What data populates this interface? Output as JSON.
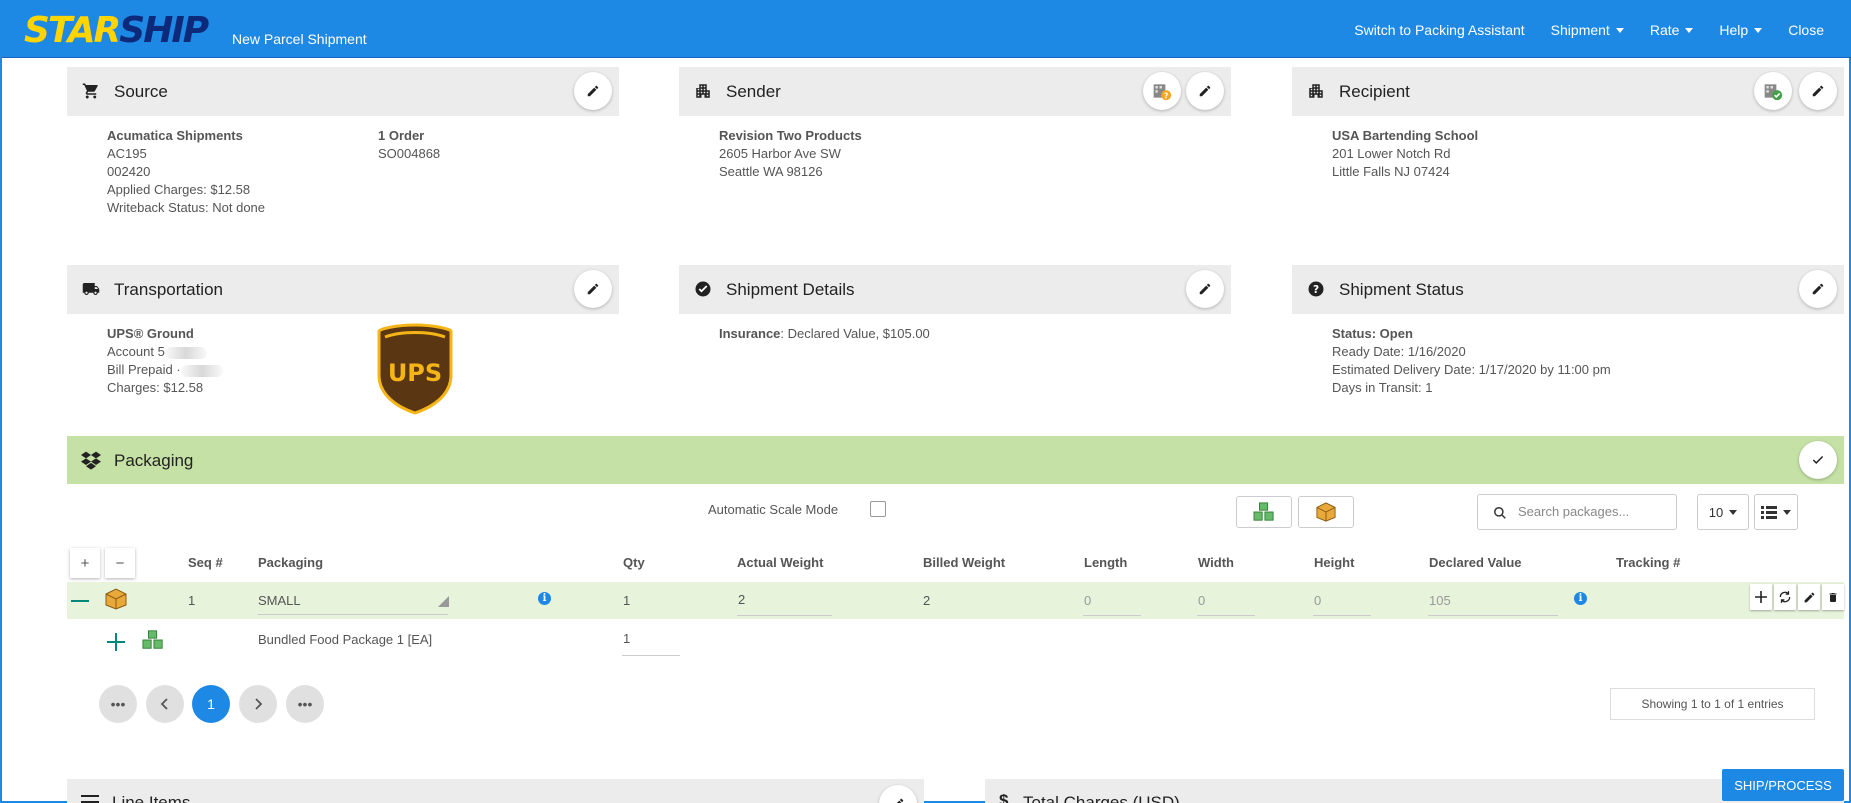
{
  "header": {
    "logo_star": "STAR",
    "logo_ship": "SHIP",
    "app_title": "New Parcel Shipment",
    "nav": {
      "packing_assistant": "Switch to Packing Assistant",
      "shipment": "Shipment",
      "rate": "Rate",
      "help": "Help",
      "close": "Close"
    }
  },
  "source": {
    "title": "Source",
    "name": "Acumatica Shipments",
    "line1": "AC195",
    "line2": "002420",
    "applied_charges": "Applied Charges: $12.58",
    "writeback": "Writeback Status: Not done",
    "order_count": "1 Order",
    "order_id": "SO004868"
  },
  "sender": {
    "title": "Sender",
    "name": "Revision Two Products",
    "address1": "2605 Harbor Ave SW",
    "address2": "Seattle WA 98126"
  },
  "recipient": {
    "title": "Recipient",
    "name": "USA Bartending School",
    "address1": "201 Lower Notch Rd",
    "address2": "Little Falls NJ 07424"
  },
  "transportation": {
    "title": "Transportation",
    "service": "UPS® Ground",
    "account": "Account 5",
    "bill": "Bill Prepaid ·",
    "charges": "Charges: $12.58",
    "carrier_logo_text": "UPS"
  },
  "shipment_details": {
    "title": "Shipment Details",
    "insurance_label": "Insurance",
    "insurance_value": ": Declared Value, $105.00"
  },
  "shipment_status": {
    "title": "Shipment Status",
    "status": "Status: Open",
    "ready_date": "Ready Date: 1/16/2020",
    "est_delivery": "Estimated Delivery Date: 1/17/2020 by 11:00 pm",
    "days_in_transit": "Days in Transit: 1"
  },
  "packaging": {
    "title": "Packaging",
    "auto_scale_label": "Automatic Scale Mode",
    "search_placeholder": "Search packages...",
    "page_size": "10",
    "expand_all": "+",
    "collapse_all": "−",
    "columns": [
      "Seq #",
      "Packaging",
      "Qty",
      "Actual Weight",
      "Billed Weight",
      "Length",
      "Width",
      "Height",
      "Declared Value",
      "Tracking #"
    ],
    "row": {
      "seq": "1",
      "packaging": "SMALL",
      "qty": "1",
      "actual_weight": "2",
      "billed_weight": "2",
      "length": "0",
      "width": "0",
      "height": "0",
      "declared_value": "105",
      "tracking": ""
    },
    "sub_item": {
      "name": "Bundled Food Package 1 [EA]",
      "qty": "1"
    },
    "pager": {
      "first": "•••",
      "current": "1",
      "last": "•••"
    },
    "entries_text": "Showing 1 to 1 of 1 entries"
  },
  "line_items": {
    "title": "Line Items"
  },
  "total_charges": {
    "title": "Total Charges (USD)"
  },
  "ship_button": "SHIP/PROCESS",
  "colors": {
    "primary": "#1e88e5",
    "packaging_header": "#c5e1a5",
    "row_highlight": "#e8f3dc",
    "logo_yellow": "#ffd400",
    "logo_navy": "#0d2a7a",
    "ups_brown": "#5a3612",
    "ups_gold": "#f5b517"
  }
}
